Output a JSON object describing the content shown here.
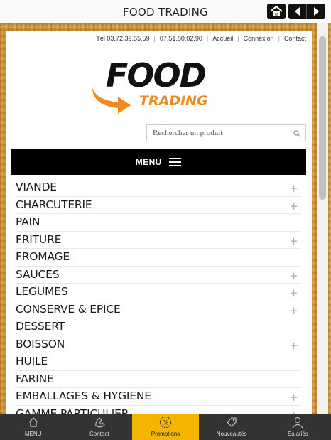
{
  "app": {
    "title": "FOOD TRADING"
  },
  "header": {
    "phone1": "Tél 03.72.39.55.59",
    "phone2": "07.51.80.02.90",
    "links": [
      "Accueil",
      "Connexion",
      "Contact"
    ],
    "logo_word1": "FOOD",
    "logo_word2": "TRADING"
  },
  "search": {
    "placeholder": "Rechercher un produit"
  },
  "menu": {
    "label": "MENU",
    "categories": [
      {
        "label": "VIANDE",
        "expandable": true
      },
      {
        "label": "CHARCUTERIE",
        "expandable": true
      },
      {
        "label": "PAIN",
        "expandable": false
      },
      {
        "label": "FRITURE",
        "expandable": true
      },
      {
        "label": "FROMAGE",
        "expandable": false
      },
      {
        "label": "SAUCES",
        "expandable": true
      },
      {
        "label": "LEGUMES",
        "expandable": true
      },
      {
        "label": "CONSERVE & EPICE",
        "expandable": true
      },
      {
        "label": "DESSERT",
        "expandable": false
      },
      {
        "label": "BOISSON",
        "expandable": true
      },
      {
        "label": "HUILE",
        "expandable": false
      },
      {
        "label": "FARINE",
        "expandable": false
      },
      {
        "label": "EMBALLAGES & HYGIENE",
        "expandable": true
      },
      {
        "label": "GAMME PARTICULIER",
        "expandable": true
      }
    ],
    "expand_symbol": "+"
  },
  "tabbar": {
    "tabs": [
      {
        "label": "MENU",
        "icon": "home-icon"
      },
      {
        "label": "Contact",
        "icon": "phone-icon"
      },
      {
        "label": "Promotions",
        "icon": "percent-badge-icon"
      },
      {
        "label": "Nouveautés",
        "icon": "tag-icon"
      },
      {
        "label": "Salariés",
        "icon": "user-icon"
      }
    ],
    "active_index": 2
  },
  "colors": {
    "accent": "#f5b400",
    "logo_orange": "#f08a1c",
    "menubar": "#000000"
  }
}
